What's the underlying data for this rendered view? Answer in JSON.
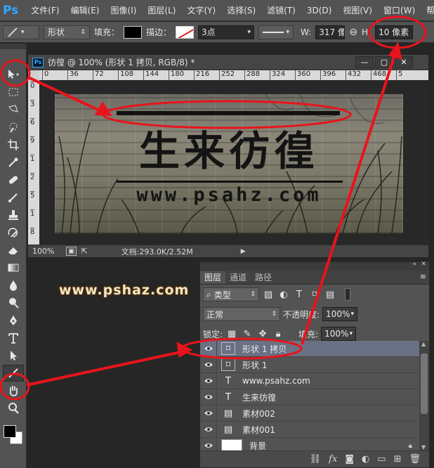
{
  "menubar": {
    "logo": "Ps",
    "items": [
      "文件(F)",
      "编辑(E)",
      "图像(I)",
      "图层(L)",
      "文字(Y)",
      "选择(S)",
      "滤镜(T)",
      "3D(D)",
      "视图(V)",
      "窗口(W)",
      "帮助"
    ]
  },
  "options": {
    "mode": "形状",
    "fill_label": "填充：",
    "stroke_label": "描边：",
    "stroke_width": "3点",
    "w_label": "W:",
    "w_value": "317 像",
    "h_label": "H:",
    "h_value": "10 像素"
  },
  "document": {
    "badge": "Ps",
    "title": "彷徨 @ 100% (形状 1 拷贝, RGB/8) *",
    "ruler_h": [
      "0",
      "36",
      "72",
      "108",
      "144",
      "180",
      "216",
      "252",
      "288",
      "324",
      "360",
      "396",
      "432",
      "468",
      "5"
    ],
    "ruler_v": [
      "0",
      "3",
      "6",
      "9",
      "1",
      "2",
      "5",
      "1",
      "8"
    ],
    "artwork_title": "生来彷徨",
    "artwork_url": "www.psahz.com",
    "zoom": "100%",
    "file_info": "文档:293.0K/2.52M"
  },
  "watermark": "www.pshaz.com",
  "layers_panel": {
    "tabs": [
      "图层",
      "通道",
      "路径"
    ],
    "filter_type": "类型",
    "blend_mode": "正常",
    "opacity_label": "不透明度:",
    "opacity_value": "100%",
    "lock_label": "锁定:",
    "fill_label": "填充:",
    "fill_value": "100%",
    "layers": [
      {
        "name": "形状 1 拷贝",
        "kind": "shape",
        "selected": true
      },
      {
        "name": "形状 1",
        "kind": "shape",
        "selected": false
      },
      {
        "name": "www.psahz.com",
        "kind": "text",
        "selected": false
      },
      {
        "name": "生来彷徨",
        "kind": "text",
        "selected": false
      },
      {
        "name": "素材002",
        "kind": "smart",
        "selected": false
      },
      {
        "name": "素材001",
        "kind": "smart",
        "selected": false
      },
      {
        "name": "背景",
        "kind": "background",
        "selected": false
      }
    ],
    "footer_icons": [
      "link-icon",
      "fx-icon",
      "mask-icon",
      "adjustment-icon",
      "group-icon",
      "new-layer-icon",
      "trash-icon"
    ]
  },
  "colors": {
    "annotation": "#e8141c",
    "selected_layer": "#6a7184",
    "ps_blue": "#31a8ff"
  }
}
